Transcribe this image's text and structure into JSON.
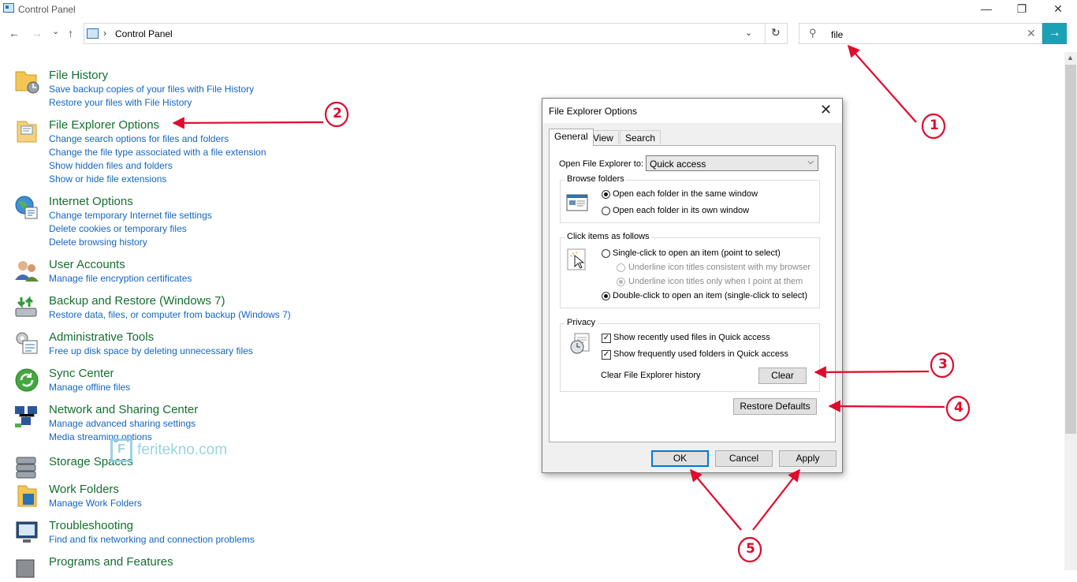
{
  "window": {
    "title": "Control Panel",
    "minimize": "—",
    "restore": "❐",
    "close": "✕"
  },
  "nav": {
    "back": "←",
    "forward": "→",
    "recent": "⌄",
    "up": "↑",
    "breadcrumb_sep": "›",
    "breadcrumb": "Control Panel",
    "dropdown": "⌄",
    "refresh": "↻"
  },
  "search": {
    "icon": "⚲",
    "value": "file",
    "clear": "✕",
    "go": "→"
  },
  "results": [
    {
      "icon": "file-history-icon",
      "title": "File History",
      "links": [
        "Save backup copies of your files with File History",
        "Restore your files with File History"
      ]
    },
    {
      "icon": "folder-options-icon",
      "title": "File Explorer Options",
      "links": [
        "Change search options for files and folders",
        "Change the file type associated with a file extension",
        "Show hidden files and folders",
        "Show or hide file extensions"
      ]
    },
    {
      "icon": "internet-options-icon",
      "title": "Internet Options",
      "links": [
        "Change temporary Internet file settings",
        "Delete cookies or temporary files",
        "Delete browsing history"
      ]
    },
    {
      "icon": "user-accounts-icon",
      "title": "User Accounts",
      "links": [
        "Manage file encryption certificates"
      ]
    },
    {
      "icon": "backup-restore-icon",
      "title": "Backup and Restore (Windows 7)",
      "links": [
        "Restore data, files, or computer from backup (Windows 7)"
      ]
    },
    {
      "icon": "admin-tools-icon",
      "title": "Administrative Tools",
      "links": [
        "Free up disk space by deleting unnecessary files"
      ]
    },
    {
      "icon": "sync-center-icon",
      "title": "Sync Center",
      "links": [
        "Manage offline files"
      ]
    },
    {
      "icon": "network-icon",
      "title": "Network and Sharing Center",
      "links": [
        "Manage advanced sharing settings",
        "Media streaming options"
      ]
    },
    {
      "icon": "storage-spaces-icon",
      "title": "Storage Spaces",
      "links": []
    },
    {
      "icon": "work-folders-icon",
      "title": "Work Folders",
      "links": [
        "Manage Work Folders"
      ]
    },
    {
      "icon": "troubleshooting-icon",
      "title": "Troubleshooting",
      "links": [
        "Find and fix networking and connection problems"
      ]
    },
    {
      "icon": "programs-features-icon",
      "title": "Programs and Features",
      "links": []
    }
  ],
  "watermark": {
    "mark": "F",
    "text": "feritekno.com"
  },
  "dialog": {
    "title": "File Explorer Options",
    "close": "✕",
    "tabs": [
      "General",
      "View",
      "Search"
    ],
    "open_label": "Open File Explorer to:",
    "open_value": "Quick access",
    "combo_arrow": "⌵",
    "browse": {
      "title": "Browse folders",
      "opt_same": "Open each folder in the same window",
      "opt_own": "Open each folder in its own window",
      "selected": "same"
    },
    "click": {
      "title": "Click items as follows",
      "single": "Single-click to open an item (point to select)",
      "underline_browser": "Underline icon titles consistent with my browser",
      "underline_point": "Underline icon titles only when I point at them",
      "double": "Double-click to open an item (single-click to select)",
      "selected": "double"
    },
    "privacy": {
      "title": "Privacy",
      "recent_files": "Show recently used files in Quick access",
      "frequent_folders": "Show frequently used folders in Quick access",
      "check": "✓",
      "clear_history_label": "Clear File Explorer history",
      "clear_button": "Clear"
    },
    "restore_defaults": "Restore Defaults",
    "ok": "OK",
    "cancel": "Cancel",
    "apply": "Apply"
  },
  "annotations": {
    "step1": "1",
    "step2": "2",
    "step3": "3",
    "step4": "4",
    "step5": "5",
    "color": "#e00b2d"
  }
}
